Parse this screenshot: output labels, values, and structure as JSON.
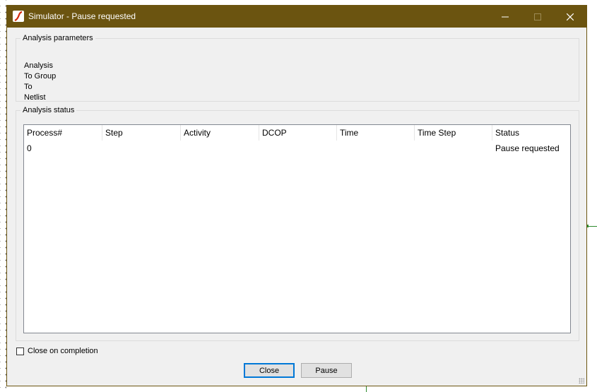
{
  "window": {
    "title": "Simulator - Pause requested",
    "icon": "ltspice-icon"
  },
  "titlebar_buttons": {
    "minimize": "minimize-icon",
    "maximize": "maximize-icon",
    "close": "close-icon"
  },
  "analysis_parameters": {
    "legend": "Analysis parameters",
    "lines": [
      "Analysis",
      "To Group",
      "To",
      "Netlist"
    ]
  },
  "analysis_status": {
    "legend": "Analysis status",
    "columns": [
      "Process#",
      "Step",
      "Activity",
      "DCOP",
      "Time",
      "Time Step",
      "Status"
    ],
    "rows": [
      {
        "process": "0",
        "step": "",
        "activity": "",
        "dcop": "",
        "time": "",
        "time_step": "",
        "status": "Pause requested"
      }
    ]
  },
  "options": {
    "close_on_completion_label": "Close on completion",
    "close_on_completion_checked": false
  },
  "buttons": {
    "close_label": "Close",
    "pause_label": "Pause"
  },
  "colors": {
    "titlebar": "#6b5410",
    "accent": "#0078d7"
  }
}
